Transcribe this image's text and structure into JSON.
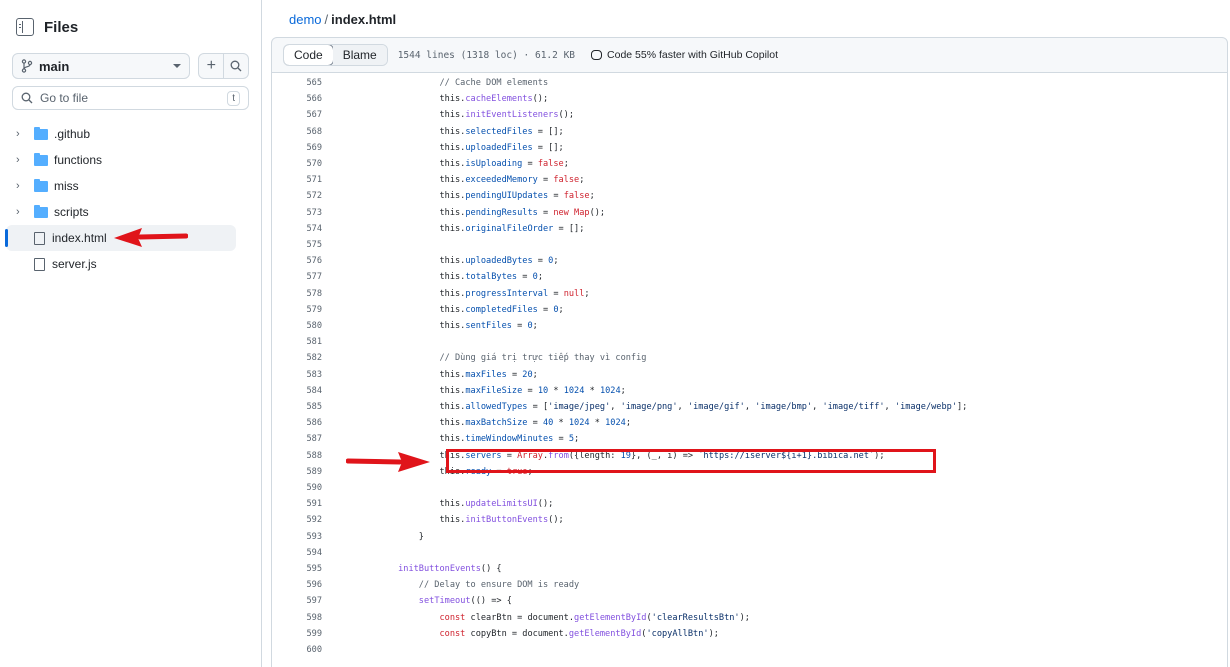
{
  "sidebar": {
    "title": "Files",
    "branch": "main",
    "goto_placeholder": "Go to file",
    "goto_key": "t",
    "items": [
      {
        "type": "folder",
        "label": ".github"
      },
      {
        "type": "folder",
        "label": "functions"
      },
      {
        "type": "folder",
        "label": "miss"
      },
      {
        "type": "folder",
        "label": "scripts"
      },
      {
        "type": "file",
        "label": "index.html",
        "selected": true
      },
      {
        "type": "file",
        "label": "server.js"
      }
    ]
  },
  "breadcrumb": {
    "repo": "demo",
    "separator": "/",
    "file": "index.html"
  },
  "file_bar": {
    "code_tab": "Code",
    "blame_tab": "Blame",
    "meta": "1544 lines (1318 loc) · 61.2 KB",
    "copilot": "Code 55% faster with GitHub Copilot"
  },
  "code": {
    "lines": [
      {
        "n": "565",
        "text": "                    // Cache DOM elements"
      },
      {
        "n": "566",
        "text": "                    this.cacheElements();"
      },
      {
        "n": "567",
        "text": "                    this.initEventListeners();"
      },
      {
        "n": "568",
        "text": "                    this.selectedFiles = [];"
      },
      {
        "n": "569",
        "text": "                    this.uploadedFiles = [];"
      },
      {
        "n": "570",
        "text": "                    this.isUploading = false;"
      },
      {
        "n": "571",
        "text": "                    this.exceededMemory = false;"
      },
      {
        "n": "572",
        "text": "                    this.pendingUIUpdates = false;"
      },
      {
        "n": "573",
        "text": "                    this.pendingResults = new Map();"
      },
      {
        "n": "574",
        "text": "                    this.originalFileOrder = [];"
      },
      {
        "n": "575",
        "text": ""
      },
      {
        "n": "576",
        "text": "                    this.uploadedBytes = 0;"
      },
      {
        "n": "577",
        "text": "                    this.totalBytes = 0;"
      },
      {
        "n": "578",
        "text": "                    this.progressInterval = null;"
      },
      {
        "n": "579",
        "text": "                    this.completedFiles = 0;"
      },
      {
        "n": "580",
        "text": "                    this.sentFiles = 0;"
      },
      {
        "n": "581",
        "text": ""
      },
      {
        "n": "582",
        "text": "                    // Dùng giá trị trực tiếp thay vì config"
      },
      {
        "n": "583",
        "text": "                    this.maxFiles = 20;"
      },
      {
        "n": "584",
        "text": "                    this.maxFileSize = 10 * 1024 * 1024;"
      },
      {
        "n": "585",
        "text": "                    this.allowedTypes = ['image/jpeg', 'image/png', 'image/gif', 'image/bmp', 'image/tiff', 'image/webp'];"
      },
      {
        "n": "586",
        "text": "                    this.maxBatchSize = 40 * 1024 * 1024;"
      },
      {
        "n": "587",
        "text": "                    this.timeWindowMinutes = 5;"
      },
      {
        "n": "588",
        "text": "                    this.servers = Array.from({length: 19}, (_, i) => `https://iserver${i+1}.bibica.net`);"
      },
      {
        "n": "589",
        "text": "                    this.ready = true;"
      },
      {
        "n": "590",
        "text": ""
      },
      {
        "n": "591",
        "text": "                    this.updateLimitsUI();"
      },
      {
        "n": "592",
        "text": "                    this.initButtonEvents();"
      },
      {
        "n": "593",
        "text": "                }"
      },
      {
        "n": "594",
        "text": ""
      },
      {
        "n": "595",
        "text": "            initButtonEvents() {"
      },
      {
        "n": "596",
        "text": "                // Delay to ensure DOM is ready"
      },
      {
        "n": "597",
        "text": "                setTimeout(() => {"
      },
      {
        "n": "598",
        "text": "                    const clearBtn = document.getElementById('clearResultsBtn');"
      },
      {
        "n": "599",
        "text": "                    const copyBtn = document.getElementById('copyAllBtn');"
      },
      {
        "n": "600",
        "text": ""
      }
    ]
  },
  "colors": {
    "accent": "#0969da",
    "annotation": "#e0141a"
  }
}
